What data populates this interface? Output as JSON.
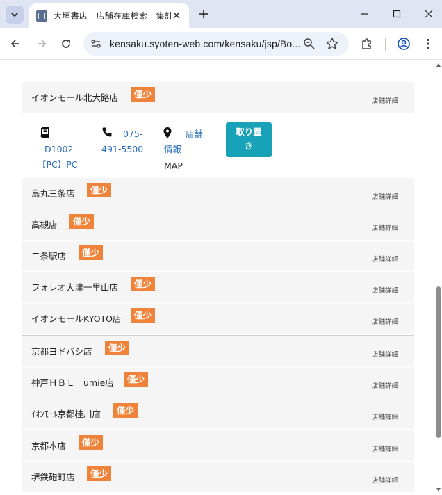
{
  "browser": {
    "tab_title": "大垣書店　店舗在庫検索　集計",
    "url": "kensaku.syoten-web.com/kensaku/jsp/Bo..."
  },
  "stores_top": {
    "name": "イオンモール北大路店",
    "badge": "僅少",
    "detail": "店舗詳細"
  },
  "expanded": {
    "shelf_line1": "D1002",
    "shelf_line2": "【PC】PC",
    "phone_line1": "075-",
    "phone_line2": "491-5500",
    "info_line1": "店舗",
    "info_line2": "情報",
    "map_label": "MAP",
    "reserve_line1": "取り置",
    "reserve_line2": "き"
  },
  "stores": [
    {
      "name": "烏丸三条店",
      "badge": "僅少",
      "detail": "店舗詳細"
    },
    {
      "name": "高槻店",
      "badge": "僅少",
      "detail": "店舗詳細"
    },
    {
      "name": "二条駅店",
      "badge": "僅少",
      "detail": "店舗詳細"
    },
    {
      "name": "フォレオ大津一里山店",
      "badge": "僅少",
      "detail": "店舗詳細"
    },
    {
      "name": "イオンモールKYOTO店",
      "badge": "僅少",
      "detail": "店舗詳細"
    },
    {
      "name": "京都ヨドバシ店",
      "badge": "僅少",
      "detail": "店舗詳細"
    },
    {
      "name": "神戸ＨＢＬ　umie店",
      "badge": "僅少",
      "detail": "店舗詳細"
    },
    {
      "name": "ｲｵﾝﾓｰﾙ京都桂川店",
      "badge": "僅少",
      "detail": "店舗詳細"
    },
    {
      "name": "京都本店",
      "badge": "僅少",
      "detail": "店舗詳細"
    },
    {
      "name": "堺鉄砲町店",
      "badge": "僅少",
      "detail": "店舗詳細"
    }
  ]
}
